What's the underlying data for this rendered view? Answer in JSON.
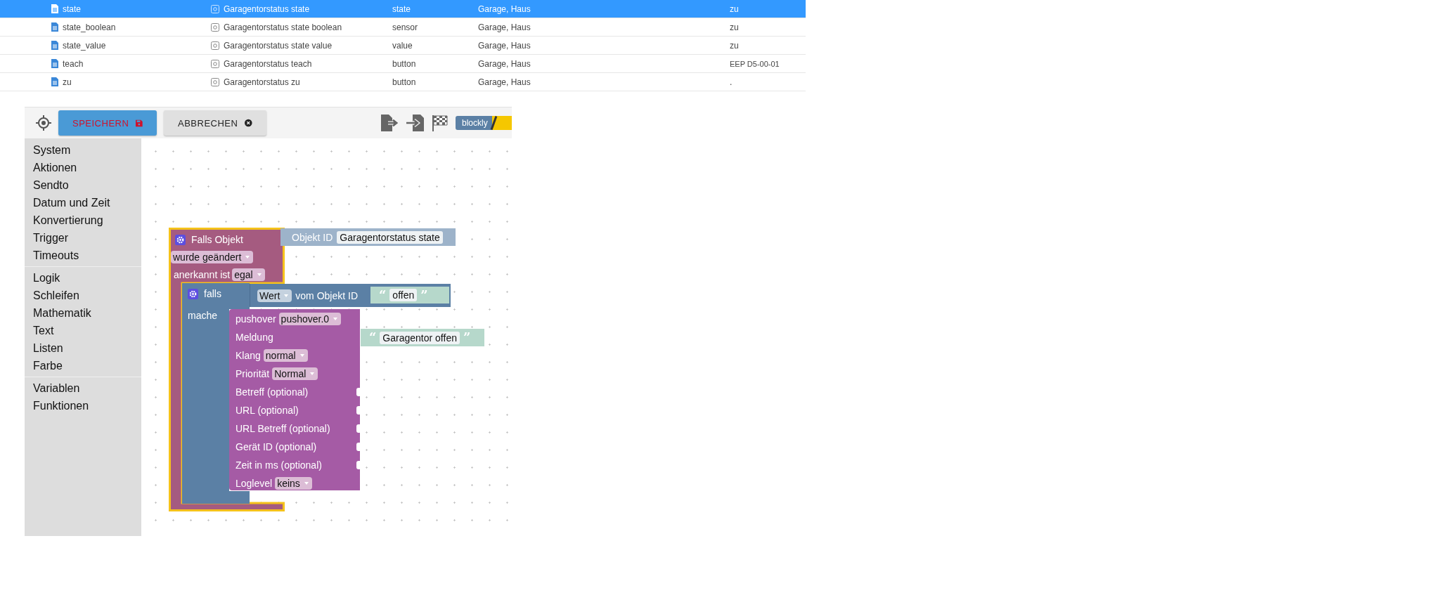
{
  "table": {
    "rows": [
      {
        "name": "state",
        "description": "Garagentorstatus state",
        "type": "state",
        "rooms": "Garage, Haus",
        "value": "zu",
        "selected": true
      },
      {
        "name": "state_boolean",
        "description": "Garagentorstatus state boolean",
        "type": "sensor",
        "rooms": "Garage, Haus",
        "value": "zu",
        "selected": false
      },
      {
        "name": "state_value",
        "description": "Garagentorstatus state value",
        "type": "value",
        "rooms": "Garage, Haus",
        "value": "zu",
        "selected": false
      },
      {
        "name": "teach",
        "description": "Garagentorstatus teach",
        "type": "button",
        "rooms": "Garage, Haus",
        "value": "EEP D5-00-01",
        "selected": false
      },
      {
        "name": "zu",
        "description": "Garagentorstatus zu",
        "type": "button",
        "rooms": "Garage, Haus",
        "value": ".",
        "selected": false
      }
    ]
  },
  "toolbar": {
    "save_button": "SPEICHERN",
    "cancel_button": "ABBRECHEN",
    "badge": "blockly"
  },
  "sidebar": {
    "groups": [
      {
        "items": [
          "System",
          "Aktionen",
          "Sendto",
          "Datum und Zeit",
          "Konvertierung",
          "Trigger",
          "Timeouts"
        ]
      },
      {
        "items": [
          "Logik",
          "Schleifen",
          "Mathematik",
          "Text",
          "Listen",
          "Farbe"
        ]
      },
      {
        "items": [
          "Variablen",
          "Funktionen"
        ]
      }
    ]
  },
  "workspace": {
    "trigger_block": {
      "header": "Falls Objekt",
      "selected": true,
      "event": "wurde geändert",
      "ack_label": "anerkannt ist",
      "ack": "egal",
      "object_label": "Objekt ID",
      "object_value": "Garagentorstatus state"
    },
    "if_block": {
      "label": "falls",
      "do_label": "mache",
      "condition": {
        "dropdown": "Wert",
        "label": "vom Objekt ID",
        "text": {
          "open": "“",
          "value": "offen",
          "close": "”"
        }
      }
    },
    "pushover_block": {
      "rows": [
        {
          "kind": "dropdown",
          "label": "pushover",
          "value": "pushover.0"
        },
        {
          "kind": "text",
          "label": "Meldung",
          "text": {
            "open": "“",
            "value": "Garagentor offen",
            "close": "”"
          }
        },
        {
          "kind": "dropdown",
          "label": "Klang",
          "value": "normal"
        },
        {
          "kind": "dropdown",
          "label": "Priorität",
          "value": "Normal"
        },
        {
          "kind": "input",
          "label": "Betreff (optional)"
        },
        {
          "kind": "input",
          "label": "URL (optional)"
        },
        {
          "kind": "input",
          "label": "URL Betreff (optional)"
        },
        {
          "kind": "input",
          "label": "Gerät ID (optional)"
        },
        {
          "kind": "input",
          "label": "Zeit in ms (optional)"
        },
        {
          "kind": "dropdown",
          "label": "Loglevel",
          "value": "keins"
        }
      ]
    }
  }
}
